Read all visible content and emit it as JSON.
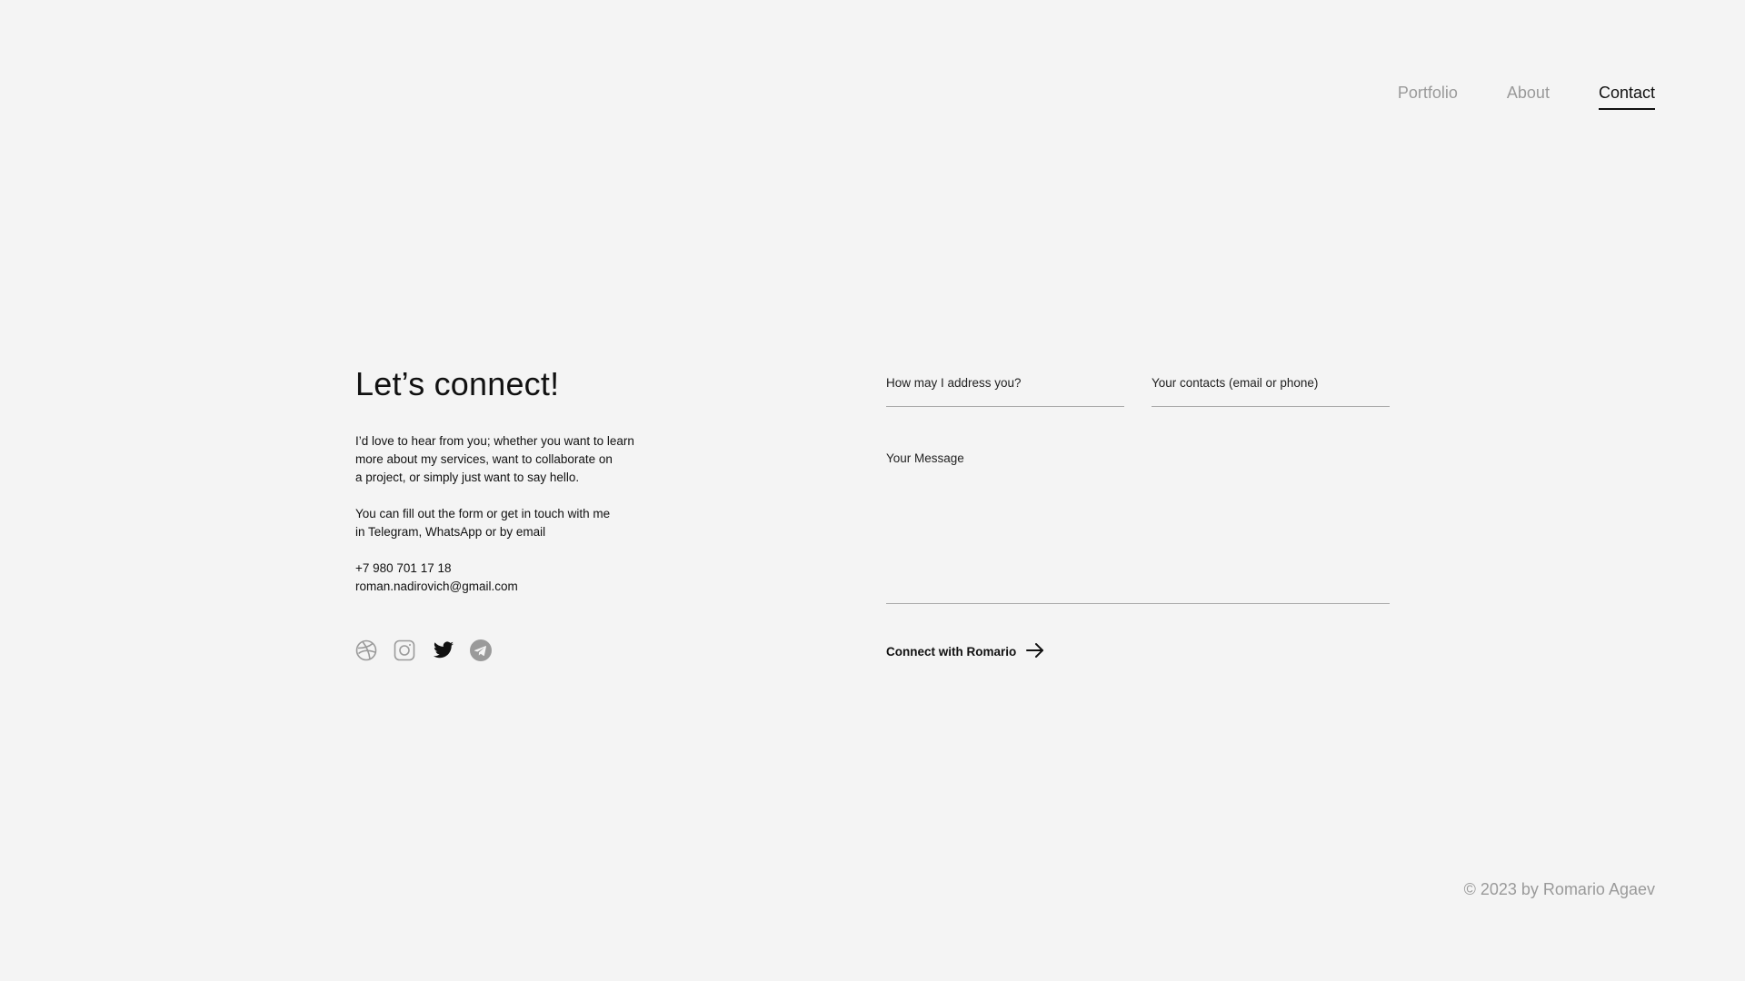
{
  "nav": {
    "items": [
      {
        "label": "Portfolio"
      },
      {
        "label": "About"
      },
      {
        "label": "Contact",
        "active": true
      }
    ]
  },
  "intro": {
    "title": "Let’s connect!",
    "para1_line1": "I’d love to hear from you; whether you want to learn",
    "para1_line2": "more about my services, want to collaborate on",
    "para1_line3": "a project, or simply just want to say hello.",
    "para2_line1": "You can fill out the form or get in touch with me",
    "para2_line2": "in Telegram, WhatsApp or by email",
    "phone": "+7 980 701 17 18",
    "email": "roman.nadirovich@gmail.com"
  },
  "socials": [
    {
      "icon": "dribbble-icon"
    },
    {
      "icon": "instagram-icon"
    },
    {
      "icon": "twitter-icon"
    },
    {
      "icon": "telegram-icon"
    }
  ],
  "form": {
    "name_placeholder": "How may I address you?",
    "contacts_placeholder": "Your contacts (email or phone)",
    "message_placeholder": "Your Message",
    "submit_label": "Connect with Romario"
  },
  "footer": {
    "copyright": "© 2023 by Romario Agaev"
  },
  "colors": {
    "background": "#f4f4f4",
    "text": "#111111",
    "muted": "#9a9a9a"
  }
}
